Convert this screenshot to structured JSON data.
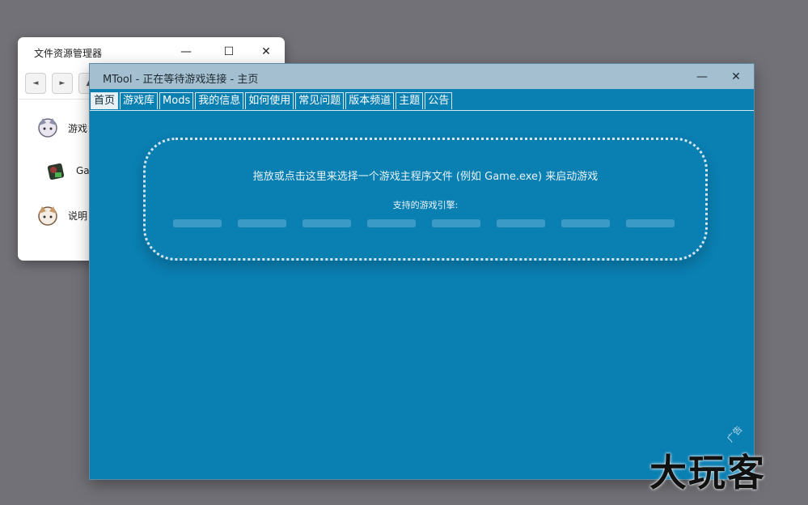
{
  "explorer": {
    "title": "文件资源管理器",
    "controls": {
      "minimize": "—",
      "maximize": "☐",
      "close": "✕"
    },
    "nav": {
      "back": "◄",
      "forward": "►",
      "up": "▲"
    },
    "items": [
      {
        "label": "游戏",
        "icon": "anime-character-icon"
      },
      {
        "label": "Ga",
        "icon": "game-exe-icon"
      },
      {
        "label": "说明",
        "icon": "anime-character-icon"
      }
    ]
  },
  "mtool": {
    "title": "MTool - 正在等待游戏连接 - 主页",
    "controls": {
      "minimize": "—",
      "close": "✕"
    },
    "tabs": [
      "首页",
      "游戏库",
      "Mods",
      "我的信息",
      "如何使用",
      "常见问题",
      "版本频道",
      "主题",
      "公告"
    ],
    "active_tab": "首页",
    "dropzone": {
      "text": "拖放或点击这里来选择一个游戏主程序文件 (例如 Game.exe) 来启动游戏",
      "engines_label": "支持的游戏引擎:",
      "engine_count": 8
    }
  },
  "watermark": {
    "text": "大玩客",
    "small_text": "广告"
  },
  "colors": {
    "desktop": "#727177",
    "mtool_bg": "#0a7fb2",
    "titlebar": "#a4bfcf",
    "engine_chip": "#3b9bc6"
  }
}
